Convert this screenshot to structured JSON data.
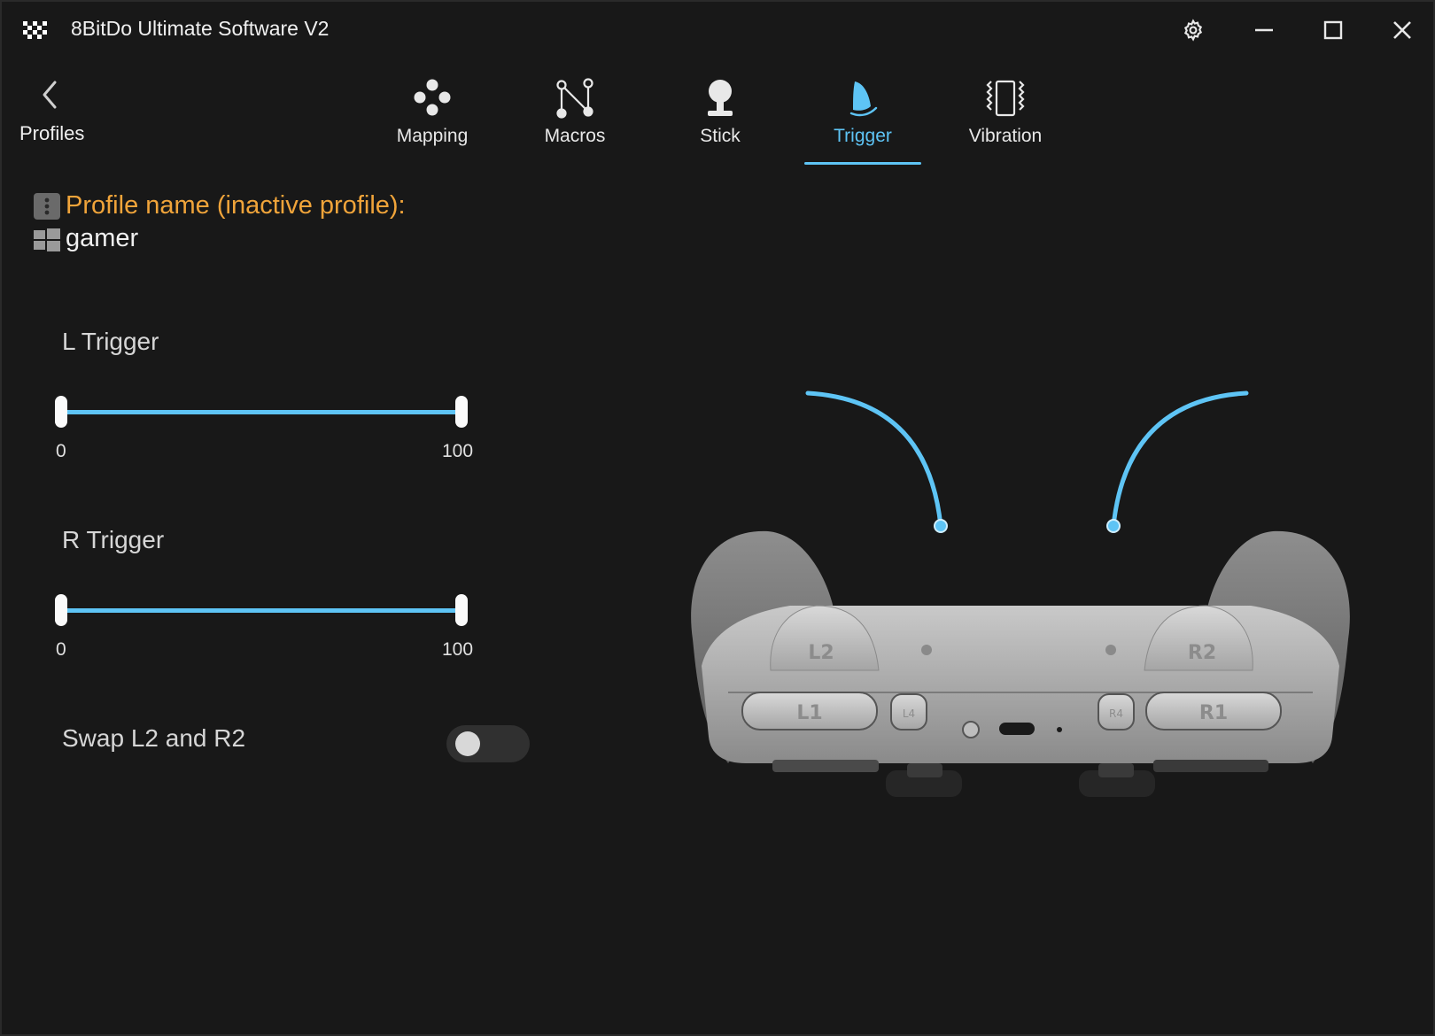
{
  "app": {
    "title": "8BitDo Ultimate Software V2"
  },
  "nav": {
    "back_label": "Profiles",
    "active_tab": "Trigger",
    "tabs": [
      {
        "label": "Mapping",
        "icon": "dpad-dots-icon"
      },
      {
        "label": "Macros",
        "icon": "macro-nodes-icon"
      },
      {
        "label": "Stick",
        "icon": "joystick-icon"
      },
      {
        "label": "Trigger",
        "icon": "trigger-icon"
      },
      {
        "label": "Vibration",
        "icon": "vibration-icon"
      }
    ]
  },
  "profile": {
    "heading": "Profile name (inactive profile):",
    "name": "gamer"
  },
  "triggers": {
    "left": {
      "label": "L Trigger",
      "min_label": "0",
      "max_label": "100",
      "range": [
        0,
        100
      ]
    },
    "right": {
      "label": "R Trigger",
      "min_label": "0",
      "max_label": "100",
      "range": [
        0,
        100
      ]
    }
  },
  "swap": {
    "label": "Swap L2 and R2",
    "enabled": false
  },
  "controller": {
    "buttons": [
      "L2",
      "R2",
      "L1",
      "R1",
      "L4",
      "R4"
    ]
  },
  "colors": {
    "accent": "#5ec4f5",
    "heading": "#f0a43a",
    "background": "#181818"
  }
}
